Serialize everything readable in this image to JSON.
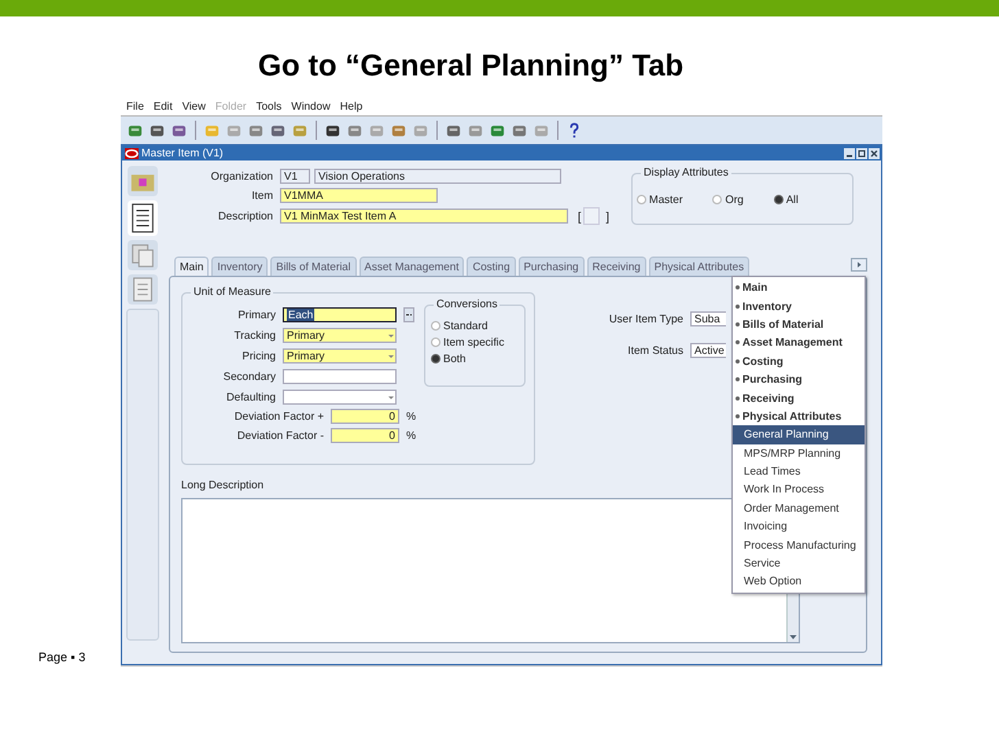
{
  "slide": {
    "title": "Go to “General Planning” Tab",
    "page_label": "Page ▪ 3"
  },
  "menu_bar": [
    {
      "label": "File",
      "disabled": false
    },
    {
      "label": "Edit",
      "disabled": false
    },
    {
      "label": "View",
      "disabled": false
    },
    {
      "label": "Folder",
      "disabled": true
    },
    {
      "label": "Tools",
      "disabled": false
    },
    {
      "label": "Window",
      "disabled": false
    },
    {
      "label": "Help",
      "disabled": false
    }
  ],
  "window": {
    "title": "Master Item (V1)"
  },
  "header": {
    "organization_label": "Organization",
    "organization_code": "V1",
    "organization_name": "Vision Operations",
    "item_label": "Item",
    "item": "V1MMA",
    "description_label": "Description",
    "description": "V1 MinMax Test Item A",
    "flexfield_open": "[",
    "flexfield_close": "]"
  },
  "display_attributes": {
    "title": "Display Attributes",
    "options": [
      {
        "label": "Master",
        "selected": false
      },
      {
        "label": "Org",
        "selected": false
      },
      {
        "label": "All",
        "selected": true
      }
    ]
  },
  "tabs": [
    {
      "label": "Main",
      "selected": true
    },
    {
      "label": "Inventory",
      "selected": false
    },
    {
      "label": "Bills of Material",
      "selected": false
    },
    {
      "label": "Asset Management",
      "selected": false
    },
    {
      "label": "Costing",
      "selected": false
    },
    {
      "label": "Purchasing",
      "selected": false
    },
    {
      "label": "Receiving",
      "selected": false
    },
    {
      "label": "Physical Attributes",
      "selected": false
    }
  ],
  "unit_of_measure": {
    "title": "Unit of Measure",
    "fields": [
      {
        "label": "Primary",
        "value": "Each",
        "kind": "lov",
        "required": true,
        "focused": true
      },
      {
        "label": "Tracking",
        "value": "Primary",
        "kind": "select",
        "required": true,
        "focused": false
      },
      {
        "label": "Pricing",
        "value": "Primary",
        "kind": "select",
        "required": true,
        "focused": false
      },
      {
        "label": "Secondary",
        "kind": "text",
        "required": false,
        "focused": false
      },
      {
        "label": "Defaulting",
        "kind": "select",
        "required": false,
        "focused": false
      }
    ],
    "factors": [
      {
        "label": "Deviation Factor +",
        "value": "0",
        "unit": "%"
      },
      {
        "label": "Deviation Factor -",
        "value": "0",
        "unit": "%"
      }
    ]
  },
  "conversions": {
    "title": "Conversions",
    "options": [
      {
        "label": "Standard",
        "selected": false
      },
      {
        "label": "Item specific",
        "selected": false
      },
      {
        "label": "Both",
        "selected": true
      }
    ]
  },
  "item_fields": [
    {
      "label": "User Item Type",
      "value": "Suba"
    },
    {
      "label": "Item Status",
      "value": "Active"
    }
  ],
  "long_description": {
    "label": "Long Description"
  },
  "tab_menu": [
    {
      "label": "Main",
      "kind": "tab",
      "selected": false
    },
    {
      "label": "Inventory",
      "kind": "tab",
      "selected": false
    },
    {
      "label": "Bills of Material",
      "kind": "tab",
      "selected": false
    },
    {
      "label": "Asset Management",
      "kind": "tab",
      "selected": false
    },
    {
      "label": "Costing",
      "kind": "tab",
      "selected": false
    },
    {
      "label": "Purchasing",
      "kind": "tab",
      "selected": false
    },
    {
      "label": "Receiving",
      "kind": "tab",
      "selected": false
    },
    {
      "label": "Physical Attributes",
      "kind": "tab",
      "selected": false
    },
    {
      "label": "General Planning",
      "kind": "page",
      "selected": true
    },
    {
      "label": "MPS/MRP Planning",
      "kind": "page",
      "selected": false
    },
    {
      "label": "Lead Times",
      "kind": "page",
      "selected": false
    },
    {
      "label": "Work In Process",
      "kind": "page",
      "selected": false
    },
    {
      "label": "Order Management",
      "kind": "page",
      "selected": false
    },
    {
      "label": "Invoicing",
      "kind": "page",
      "selected": false
    },
    {
      "label": "Process Manufacturing",
      "kind": "page",
      "selected": false
    },
    {
      "label": "Service",
      "kind": "page",
      "selected": false
    },
    {
      "label": "Web Option",
      "kind": "page",
      "selected": false
    }
  ]
}
